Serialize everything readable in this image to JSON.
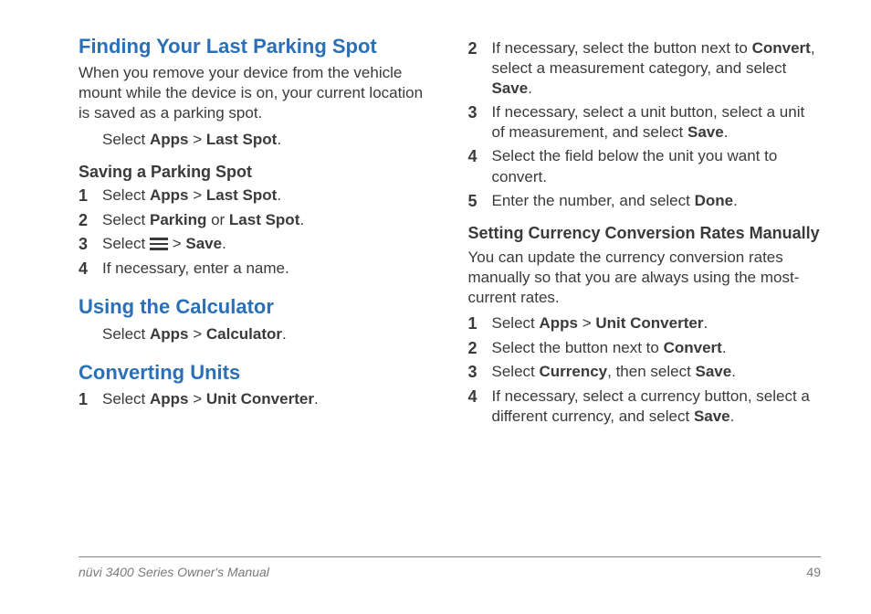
{
  "left": {
    "h_parking": "Finding Your Last Parking Spot",
    "p_parking_intro": "When you remove your device from the vehicle mount while the device is on, your current location is saved as a parking spot.",
    "parking_select_pre": "Select ",
    "apps": "Apps",
    "gt": " > ",
    "last_spot": "Last Spot",
    "period": ".",
    "h_saving": "Saving a Parking Spot",
    "save_steps": [
      {
        "n": "1",
        "pre": "Select ",
        "b1": "Apps",
        "mid": " > ",
        "b2": "Last Spot",
        "post": "."
      },
      {
        "n": "2",
        "pre": "Select ",
        "b1": "Parking",
        "mid": " or ",
        "b2": "Last Spot",
        "post": "."
      },
      {
        "n": "3",
        "pre": "Select ",
        "icon": true,
        "mid": " > ",
        "b2": "Save",
        "post": "."
      },
      {
        "n": "4",
        "pre": "If necessary, enter a name."
      }
    ],
    "h_calc": "Using the Calculator",
    "calc_select_pre": "Select ",
    "calculator": "Calculator",
    "h_convert": "Converting Units",
    "convert_steps": [
      {
        "n": "1",
        "pre": "Select ",
        "b1": "Apps",
        "mid": " > ",
        "b2": "Unit Converter",
        "post": "."
      }
    ]
  },
  "right": {
    "cont_steps": [
      {
        "n": "2",
        "pre": "If necessary, select the button next to ",
        "b1": "Convert",
        "mid": ", select a measurement category, and select ",
        "b2": "Save",
        "post": "."
      },
      {
        "n": "3",
        "pre": "If necessary, select a unit button, select a unit of measurement, and select ",
        "b1": "Save",
        "post": "."
      },
      {
        "n": "4",
        "pre": "Select the field below the unit you want to convert."
      },
      {
        "n": "5",
        "pre": "Enter the number, and select ",
        "b1": "Done",
        "post": "."
      }
    ],
    "h_currency": "Setting Currency Conversion Rates Manually",
    "p_currency": "You can update the currency conversion rates manually so that you are always using the most-current rates.",
    "currency_steps": [
      {
        "n": "1",
        "pre": "Select ",
        "b1": "Apps",
        "mid": " > ",
        "b2": "Unit Converter",
        "post": "."
      },
      {
        "n": "2",
        "pre": "Select the button next to ",
        "b1": "Convert",
        "post": "."
      },
      {
        "n": "3",
        "pre": "Select ",
        "b1": "Currency",
        "mid": ", then select ",
        "b2": "Save",
        "post": "."
      },
      {
        "n": "4",
        "pre": "If necessary, select a currency button, select a different currency, and select ",
        "b1": "Save",
        "post": "."
      }
    ]
  },
  "footer": {
    "title": "nüvi 3400 Series Owner's Manual",
    "page": "49"
  }
}
